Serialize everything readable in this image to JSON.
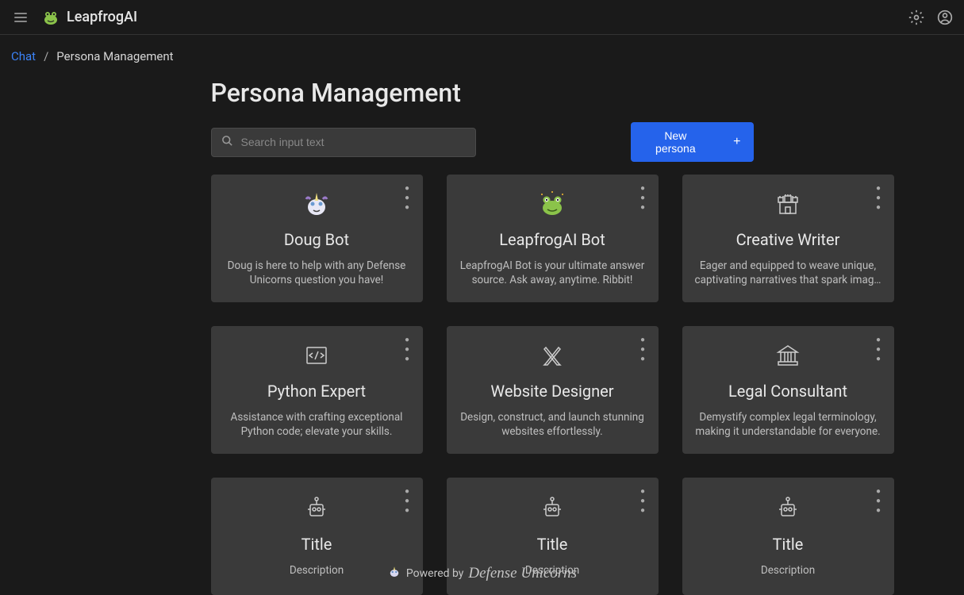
{
  "header": {
    "logo_text": "LeapfrogAI"
  },
  "breadcrumb": {
    "link_label": "Chat",
    "current": "Persona Management"
  },
  "page": {
    "title": "Persona Management"
  },
  "search": {
    "placeholder": "Search input text",
    "value": ""
  },
  "toolbar": {
    "new_button": "New persona"
  },
  "personas": [
    {
      "title": "Doug Bot",
      "description": "Doug is here to help with any Defense Unicorns question you have!",
      "icon": "unicorn"
    },
    {
      "title": "LeapfrogAI Bot",
      "description": "LeapfrogAI Bot is your ultimate answer source. Ask away, anytime. Ribbit!",
      "icon": "frog"
    },
    {
      "title": "Creative Writer",
      "description": "Eager and equipped to weave unique, captivating narratives that spark imag…",
      "icon": "castle"
    },
    {
      "title": "Python Expert",
      "description": "Assistance with crafting exceptional Python code; elevate your skills.",
      "icon": "code"
    },
    {
      "title": "Website Designer",
      "description": "Design, construct, and launch stunning websites effortlessly.",
      "icon": "design"
    },
    {
      "title": "Legal Consultant",
      "description": "Demystify complex legal terminology, making it understandable for everyone.",
      "icon": "legal"
    },
    {
      "title": "Title",
      "description": "Description",
      "icon": "robot"
    },
    {
      "title": "Title",
      "description": "Description",
      "icon": "robot"
    },
    {
      "title": "Title",
      "description": "Description",
      "icon": "robot"
    }
  ],
  "footer": {
    "powered_by": "Powered by",
    "brand": "Defense Unicorns"
  }
}
